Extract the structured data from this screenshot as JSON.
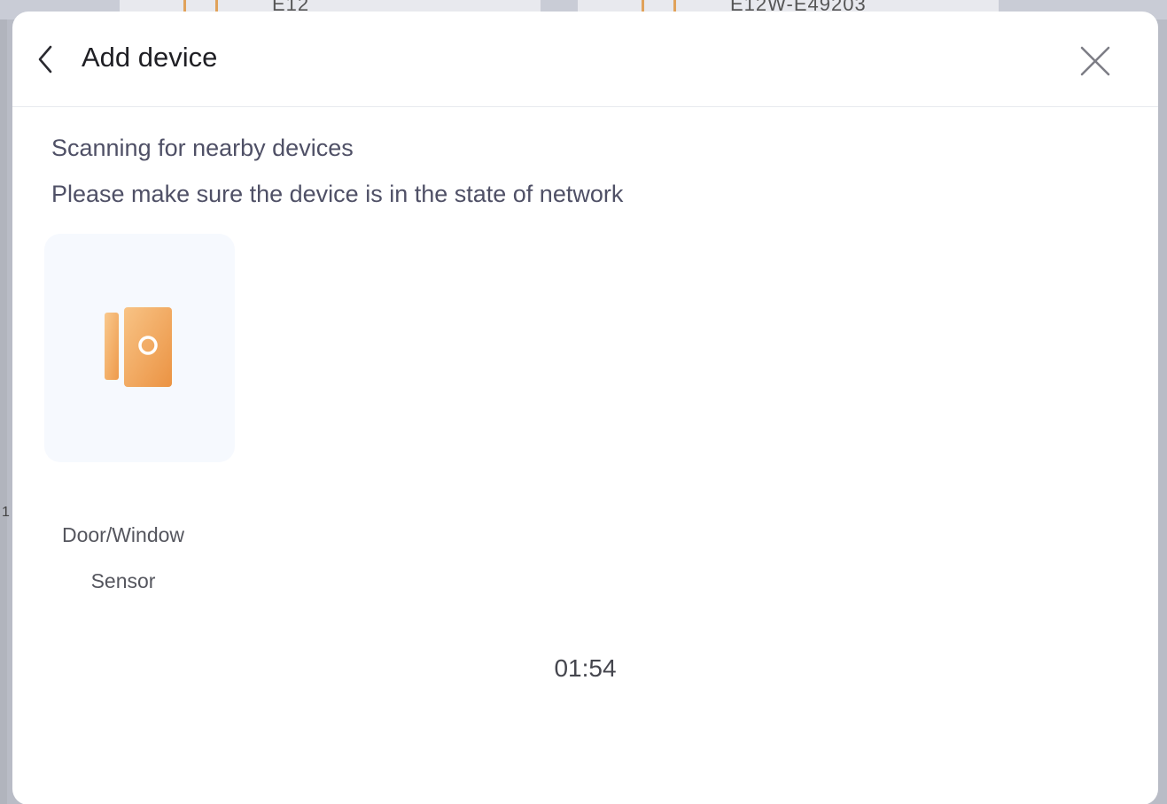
{
  "background": {
    "card1_text": "E12",
    "card2_text": "E12W-E49203",
    "side_digit": "1"
  },
  "dialog": {
    "title": "Add device",
    "back_icon": "chevron-left-icon",
    "close_icon": "close-icon"
  },
  "scan": {
    "status": "Scanning for nearby devices",
    "hint": "Please make sure the device is in the state of network",
    "timer": "01:54"
  },
  "devices": [
    {
      "label_line1": "Door/Window",
      "label_line2": "Sensor",
      "icon": "door-window-sensor-icon",
      "icon_colors": [
        "#f7c58b",
        "#ee9a4a"
      ]
    }
  ],
  "colors": {
    "title_text": "#1f1f24",
    "body_text": "#4f5066",
    "tile_background": "#f6f9fe",
    "accent_orange": "#f0a055"
  }
}
